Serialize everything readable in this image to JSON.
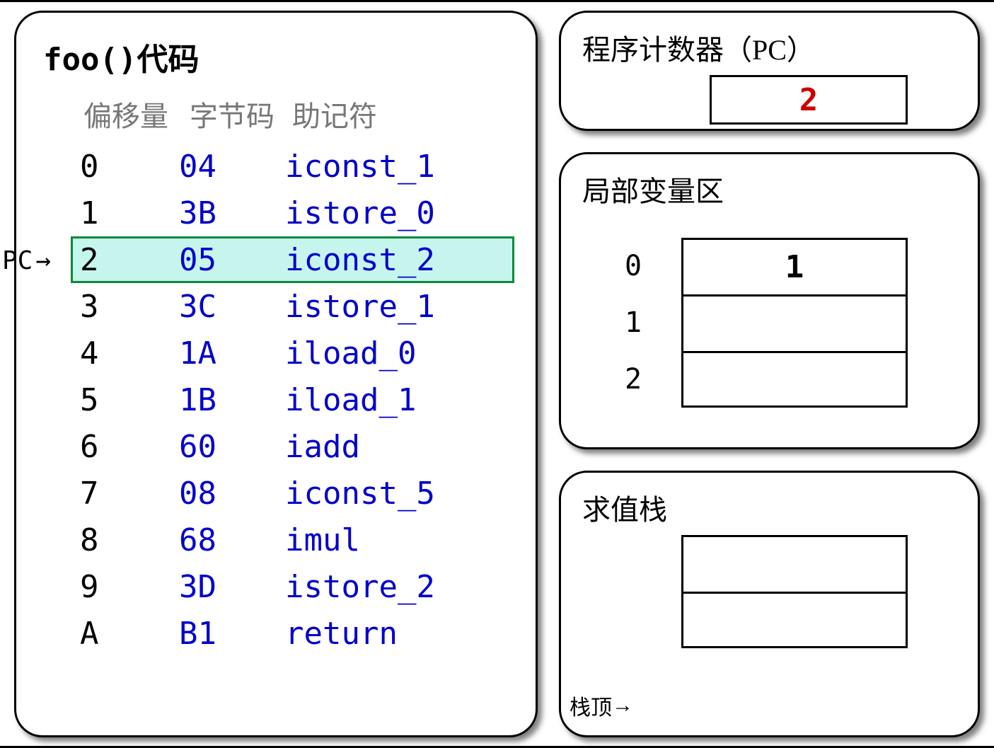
{
  "code_panel": {
    "title": "foo()代码",
    "headers": {
      "offset": "偏移量",
      "bytecode": "字节码",
      "mnemonic": "助记符"
    },
    "pc_arrow_label": "PC",
    "rows": [
      {
        "offset": "0",
        "bytecode": "04",
        "mnemonic": "iconst_1",
        "current": false
      },
      {
        "offset": "1",
        "bytecode": "3B",
        "mnemonic": "istore_0",
        "current": false
      },
      {
        "offset": "2",
        "bytecode": "05",
        "mnemonic": "iconst_2",
        "current": true
      },
      {
        "offset": "3",
        "bytecode": "3C",
        "mnemonic": "istore_1",
        "current": false
      },
      {
        "offset": "4",
        "bytecode": "1A",
        "mnemonic": "iload_0",
        "current": false
      },
      {
        "offset": "5",
        "bytecode": "1B",
        "mnemonic": "iload_1",
        "current": false
      },
      {
        "offset": "6",
        "bytecode": "60",
        "mnemonic": "iadd",
        "current": false
      },
      {
        "offset": "7",
        "bytecode": "08",
        "mnemonic": "iconst_5",
        "current": false
      },
      {
        "offset": "8",
        "bytecode": "68",
        "mnemonic": "imul",
        "current": false
      },
      {
        "offset": "9",
        "bytecode": "3D",
        "mnemonic": "istore_2",
        "current": false
      },
      {
        "offset": "A",
        "bytecode": "B1",
        "mnemonic": "return",
        "current": false
      }
    ]
  },
  "pc_panel": {
    "title": "程序计数器（PC）",
    "value": "2"
  },
  "locals_panel": {
    "title": "局部变量区",
    "slots": [
      {
        "index": "0",
        "value": "1"
      },
      {
        "index": "1",
        "value": ""
      },
      {
        "index": "2",
        "value": ""
      }
    ]
  },
  "stack_panel": {
    "title": "求值栈",
    "top_label": "栈顶",
    "cells": [
      {
        "value": ""
      },
      {
        "value": ""
      }
    ]
  }
}
